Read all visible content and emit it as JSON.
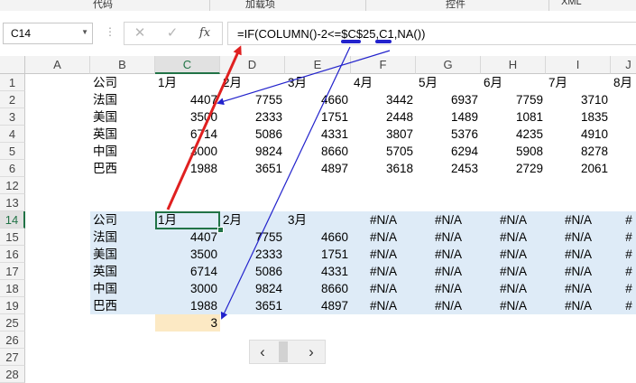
{
  "ribbon": {
    "tabs": [
      "代码",
      "加载项",
      "控件",
      "XML"
    ]
  },
  "name_box": "C14",
  "formula_bar": {
    "cancel_icon": "✕",
    "enter_icon": "✓",
    "fx_label": "fx",
    "formula": "=IF(COLUMN()-2<=$C$25,C1,NA())"
  },
  "columns": [
    "A",
    "B",
    "C",
    "D",
    "E",
    "F",
    "G",
    "H",
    "I",
    "J"
  ],
  "top_table": {
    "header": [
      "公司",
      "1月",
      "2月",
      "3月",
      "4月",
      "5月",
      "6月",
      "7月",
      "8月"
    ],
    "rows": [
      {
        "name": "法国",
        "values": [
          "4407",
          "7755",
          "4660",
          "3442",
          "6937",
          "7759",
          "3710"
        ]
      },
      {
        "name": "美国",
        "values": [
          "3500",
          "2333",
          "1751",
          "2448",
          "1489",
          "1081",
          "1835"
        ]
      },
      {
        "name": "英国",
        "values": [
          "6714",
          "5086",
          "4331",
          "3807",
          "5376",
          "4235",
          "4910"
        ]
      },
      {
        "name": "中国",
        "values": [
          "3000",
          "9824",
          "8660",
          "5705",
          "6294",
          "5908",
          "8278"
        ]
      },
      {
        "name": "巴西",
        "values": [
          "1988",
          "3651",
          "4897",
          "3618",
          "2453",
          "2729",
          "2061"
        ]
      }
    ]
  },
  "bottom_table": {
    "header": [
      "公司",
      "1月",
      "2月",
      "3月",
      "#N/A",
      "#N/A",
      "#N/A",
      "#N/A",
      "#"
    ],
    "rows": [
      {
        "name": "法国",
        "values": [
          "4407",
          "7755",
          "4660",
          "#N/A",
          "#N/A",
          "#N/A",
          "#N/A",
          "#"
        ]
      },
      {
        "name": "美国",
        "values": [
          "3500",
          "2333",
          "1751",
          "#N/A",
          "#N/A",
          "#N/A",
          "#N/A",
          "#"
        ]
      },
      {
        "name": "英国",
        "values": [
          "6714",
          "5086",
          "4331",
          "#N/A",
          "#N/A",
          "#N/A",
          "#N/A",
          "#"
        ]
      },
      {
        "name": "中国",
        "values": [
          "3000",
          "9824",
          "8660",
          "#N/A",
          "#N/A",
          "#N/A",
          "#N/A",
          "#"
        ]
      },
      {
        "name": "巴西",
        "values": [
          "1988",
          "3651",
          "4897",
          "#N/A",
          "#N/A",
          "#N/A",
          "#N/A",
          "#"
        ]
      }
    ]
  },
  "row_numbers": [
    "1",
    "2",
    "3",
    "4",
    "5",
    "6",
    "12",
    "13",
    "14",
    "15",
    "16",
    "17",
    "18",
    "19",
    "25",
    "26",
    "27",
    "28"
  ],
  "c25_value": "3",
  "scroll_control": {
    "left": "‹",
    "right": "›"
  },
  "colors": {
    "accent": "#217346",
    "band": "#deebf7",
    "highlight": "#fce9c4",
    "red_arrow": "#e02020",
    "blue_arrow": "#2222cc"
  }
}
